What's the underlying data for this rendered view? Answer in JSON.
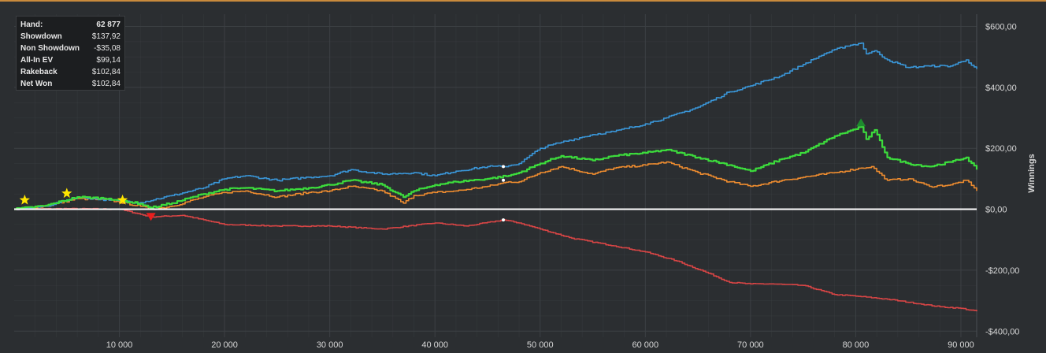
{
  "stats": {
    "rows": [
      {
        "label": "Hand:",
        "value": "62 877"
      },
      {
        "label": "Showdown",
        "value": "$137,92"
      },
      {
        "label": "Non Showdown",
        "value": "-$35,08"
      },
      {
        "label": "All-In EV",
        "value": "$99,14"
      },
      {
        "label": "Rakeback",
        "value": "$102,84"
      },
      {
        "label": "Net Won",
        "value": "$102,84"
      }
    ]
  },
  "colors": {
    "background": "#2b2e31",
    "grid": "#3c4044",
    "axis_text": "#d8d8d8",
    "zero_line": "#ffffff",
    "marker_star": "#ffe600",
    "marker_down": "#e81e1e",
    "marker_up": "#1e8a2e"
  },
  "chart_data": {
    "type": "line",
    "ylabel": "Winnings",
    "xlabel": "",
    "xlim": [
      0,
      91500
    ],
    "ylim": [
      -420,
      640
    ],
    "x_ticks": [
      10000,
      20000,
      30000,
      40000,
      50000,
      60000,
      70000,
      80000,
      90000
    ],
    "x_tick_labels": [
      "10 000",
      "20 000",
      "30 000",
      "40 000",
      "50 000",
      "60 000",
      "70 000",
      "80 000",
      "90 000"
    ],
    "y_ticks": [
      600,
      400,
      200,
      0,
      -200,
      -400
    ],
    "y_tick_labels": [
      "$600,00",
      "$400,00",
      "$200,00",
      "$0,00",
      "-$200,00",
      "-$400,00"
    ],
    "grid": true,
    "legend": "none",
    "series": [
      {
        "key": "blue",
        "color": "#3a96d8",
        "points": [
          [
            0,
            0
          ],
          [
            3000,
            10
          ],
          [
            6000,
            40
          ],
          [
            9000,
            30
          ],
          [
            12000,
            22
          ],
          [
            15000,
            45
          ],
          [
            18000,
            70
          ],
          [
            20000,
            100
          ],
          [
            22000,
            110
          ],
          [
            25000,
            95
          ],
          [
            28000,
            105
          ],
          [
            30000,
            110
          ],
          [
            32000,
            130
          ],
          [
            35000,
            115
          ],
          [
            38000,
            120
          ],
          [
            40000,
            110
          ],
          [
            42000,
            125
          ],
          [
            45000,
            140
          ],
          [
            46500,
            140
          ],
          [
            48000,
            150
          ],
          [
            50000,
            200
          ],
          [
            52000,
            220
          ],
          [
            55000,
            245
          ],
          [
            57000,
            255
          ],
          [
            60000,
            280
          ],
          [
            62000,
            300
          ],
          [
            65000,
            335
          ],
          [
            68000,
            385
          ],
          [
            70000,
            405
          ],
          [
            73000,
            440
          ],
          [
            75000,
            475
          ],
          [
            77000,
            510
          ],
          [
            79000,
            535
          ],
          [
            80500,
            545
          ],
          [
            81000,
            510
          ],
          [
            81800,
            520
          ],
          [
            83000,
            490
          ],
          [
            85000,
            465
          ],
          [
            87000,
            470
          ],
          [
            89000,
            470
          ],
          [
            90500,
            490
          ],
          [
            91500,
            460
          ]
        ]
      },
      {
        "key": "orange",
        "color": "#ee8c2f",
        "points": [
          [
            0,
            0
          ],
          [
            3000,
            10
          ],
          [
            6000,
            35
          ],
          [
            9000,
            30
          ],
          [
            12000,
            10
          ],
          [
            13000,
            0
          ],
          [
            15000,
            10
          ],
          [
            18000,
            40
          ],
          [
            20000,
            55
          ],
          [
            22000,
            60
          ],
          [
            25000,
            40
          ],
          [
            28000,
            55
          ],
          [
            30000,
            60
          ],
          [
            32000,
            75
          ],
          [
            35000,
            60
          ],
          [
            37000,
            20
          ],
          [
            38000,
            45
          ],
          [
            40000,
            55
          ],
          [
            42000,
            60
          ],
          [
            45000,
            75
          ],
          [
            47000,
            90
          ],
          [
            48000,
            90
          ],
          [
            50000,
            120
          ],
          [
            52000,
            140
          ],
          [
            55000,
            115
          ],
          [
            57000,
            135
          ],
          [
            60000,
            145
          ],
          [
            62000,
            155
          ],
          [
            65000,
            120
          ],
          [
            68000,
            90
          ],
          [
            70000,
            75
          ],
          [
            73000,
            95
          ],
          [
            75000,
            105
          ],
          [
            78000,
            120
          ],
          [
            80500,
            135
          ],
          [
            81500,
            140
          ],
          [
            83000,
            95
          ],
          [
            85000,
            100
          ],
          [
            87000,
            75
          ],
          [
            89000,
            80
          ],
          [
            90500,
            95
          ],
          [
            91500,
            60
          ]
        ]
      },
      {
        "key": "green",
        "color": "#3cdc3c",
        "points": [
          [
            0,
            0
          ],
          [
            3000,
            12
          ],
          [
            6000,
            40
          ],
          [
            9000,
            35
          ],
          [
            12000,
            18
          ],
          [
            13000,
            5
          ],
          [
            15000,
            20
          ],
          [
            18000,
            50
          ],
          [
            20000,
            65
          ],
          [
            22000,
            70
          ],
          [
            25000,
            60
          ],
          [
            28000,
            70
          ],
          [
            30000,
            80
          ],
          [
            32000,
            95
          ],
          [
            35000,
            80
          ],
          [
            37000,
            40
          ],
          [
            38000,
            60
          ],
          [
            40000,
            80
          ],
          [
            42000,
            90
          ],
          [
            45000,
            100
          ],
          [
            47000,
            110
          ],
          [
            48000,
            120
          ],
          [
            50000,
            150
          ],
          [
            52000,
            175
          ],
          [
            55000,
            160
          ],
          [
            57000,
            175
          ],
          [
            60000,
            185
          ],
          [
            62000,
            195
          ],
          [
            65000,
            170
          ],
          [
            68000,
            145
          ],
          [
            70000,
            125
          ],
          [
            73000,
            165
          ],
          [
            75000,
            185
          ],
          [
            78000,
            240
          ],
          [
            80500,
            270
          ],
          [
            81000,
            230
          ],
          [
            81800,
            260
          ],
          [
            83000,
            170
          ],
          [
            85000,
            150
          ],
          [
            87000,
            140
          ],
          [
            89000,
            155
          ],
          [
            90500,
            170
          ],
          [
            91500,
            130
          ]
        ]
      },
      {
        "key": "red",
        "color": "#d94545",
        "points": [
          [
            0,
            0
          ],
          [
            5000,
            2
          ],
          [
            10000,
            0
          ],
          [
            13000,
            -25
          ],
          [
            16000,
            -20
          ],
          [
            20000,
            -50
          ],
          [
            25000,
            -55
          ],
          [
            30000,
            -55
          ],
          [
            35000,
            -65
          ],
          [
            40000,
            -45
          ],
          [
            43000,
            -55
          ],
          [
            46500,
            -35
          ],
          [
            48000,
            -45
          ],
          [
            50000,
            -65
          ],
          [
            53000,
            -95
          ],
          [
            57000,
            -120
          ],
          [
            60000,
            -140
          ],
          [
            63000,
            -170
          ],
          [
            66000,
            -210
          ],
          [
            68000,
            -240
          ],
          [
            70000,
            -245
          ],
          [
            72000,
            -245
          ],
          [
            75000,
            -250
          ],
          [
            78000,
            -280
          ],
          [
            80000,
            -285
          ],
          [
            83000,
            -295
          ],
          [
            86000,
            -310
          ],
          [
            88000,
            -320
          ],
          [
            90000,
            -325
          ],
          [
            91500,
            -335
          ]
        ]
      }
    ],
    "markers": [
      {
        "type": "star",
        "x": 1000,
        "y": 30
      },
      {
        "type": "star",
        "x": 5000,
        "y": 52
      },
      {
        "type": "star",
        "x": 10300,
        "y": 30
      },
      {
        "type": "down",
        "x": 13000,
        "y": -25
      },
      {
        "type": "up",
        "x": 80500,
        "y": 285
      }
    ]
  }
}
